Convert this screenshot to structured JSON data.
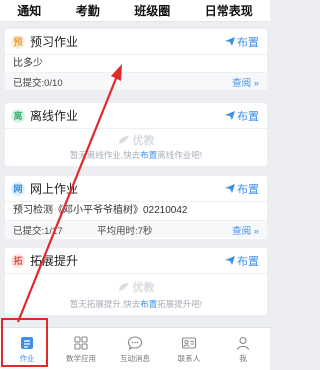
{
  "top_tabs": [
    "通知",
    "考勤",
    "班级圈",
    "日常表现"
  ],
  "cards": {
    "preview": {
      "icon_char": "预",
      "title": "预习作业",
      "assign_label": "布置",
      "content": "比多少",
      "submitted": "已提交:0/10",
      "view_label": "查阅 »"
    },
    "offline": {
      "icon_char": "离",
      "title": "离线作业",
      "assign_label": "布置",
      "logo_text": "优教",
      "empty_prefix": "暂无离线作业,快去",
      "empty_link": "布置",
      "empty_suffix": "离线作业吧!"
    },
    "online": {
      "icon_char": "网",
      "title": "网上作业",
      "assign_label": "布置",
      "content": "预习检测《邓小平爷爷植树》02210042",
      "submitted": "已提交:1/17",
      "avg_time": "平均用时:7秒",
      "view_label": "查阅 »"
    },
    "expand": {
      "icon_char": "拓",
      "title": "拓展提升",
      "assign_label": "布置",
      "logo_text": "优教",
      "empty_prefix": "暂无拓展提升,快去",
      "empty_link": "布置",
      "empty_suffix": "拓展提升吧!"
    }
  },
  "bottom_nav": [
    {
      "label": "作业",
      "icon": "homework-icon",
      "active": true
    },
    {
      "label": "数学应用",
      "icon": "apps-grid-icon",
      "active": false
    },
    {
      "label": "互动消息",
      "icon": "chat-bubble-icon",
      "active": false
    },
    {
      "label": "联系人",
      "icon": "contact-card-icon",
      "active": false
    },
    {
      "label": "我",
      "icon": "person-icon",
      "active": false
    }
  ],
  "colors": {
    "accent": "#3d8fe8",
    "annotation": "#e02a2a",
    "icon_preview": "#e9a23b",
    "icon_offline": "#37b36b",
    "icon_online": "#2f8fd8",
    "icon_expand": "#e2574c"
  }
}
